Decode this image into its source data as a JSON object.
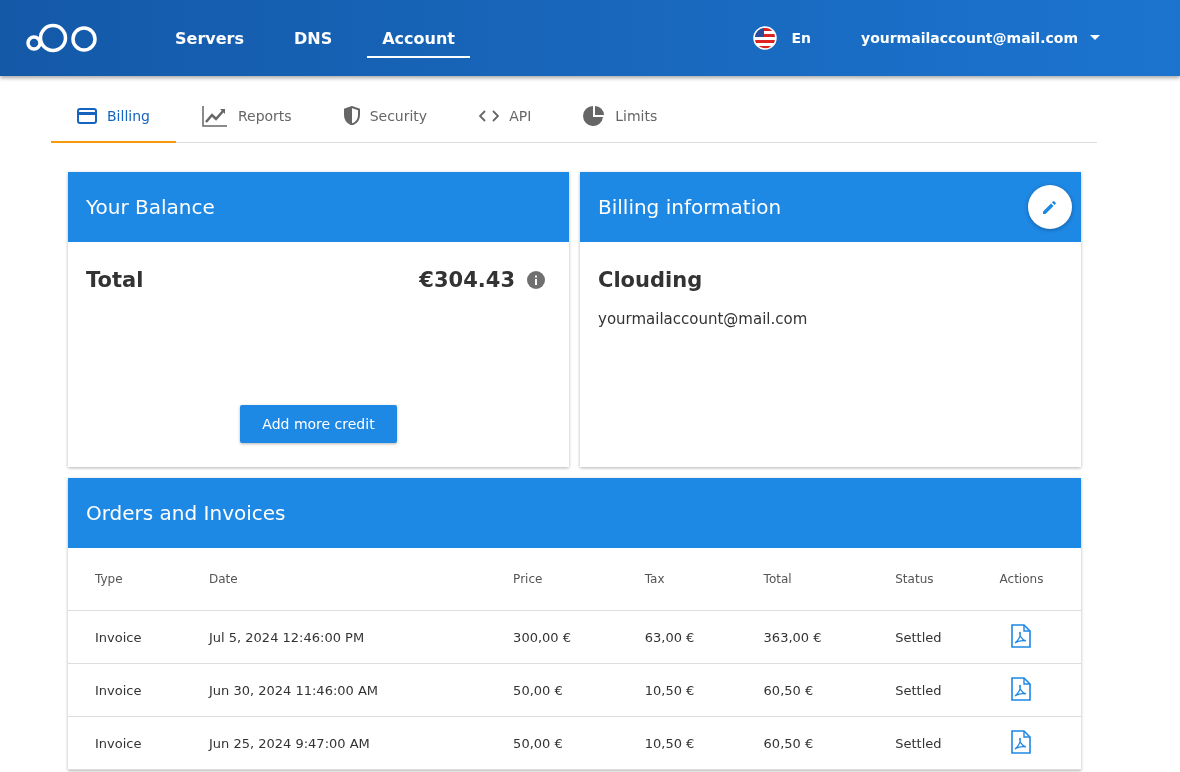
{
  "nav": {
    "items": [
      {
        "label": "Servers",
        "selected": false
      },
      {
        "label": "DNS",
        "selected": false
      },
      {
        "label": "Account",
        "selected": true
      }
    ],
    "language": "En",
    "account": "yourmailaccount@mail.com"
  },
  "tabs": [
    {
      "label": "Billing",
      "kind": "card",
      "selected": true
    },
    {
      "label": "Reports",
      "kind": "chart",
      "selected": false
    },
    {
      "label": "Security",
      "kind": "shield",
      "selected": false
    },
    {
      "label": "API",
      "kind": "code",
      "selected": false
    },
    {
      "label": "Limits",
      "kind": "pie",
      "selected": false
    }
  ],
  "balance": {
    "title": "Your Balance",
    "label": "Total",
    "amount": "€304.43",
    "button": "Add more credit"
  },
  "billing": {
    "title": "Billing information",
    "name": "Clouding",
    "email": "yourmailaccount@mail.com"
  },
  "orders": {
    "title": "Orders and Invoices",
    "columns": [
      "Type",
      "Date",
      "Price",
      "Tax",
      "Total",
      "Status",
      "Actions"
    ],
    "rows": [
      {
        "type": "Invoice",
        "date": "Jul 5, 2024 12:46:00 PM",
        "price": "300,00 €",
        "tax": "63,00 €",
        "total": "363,00 €",
        "status": "Settled"
      },
      {
        "type": "Invoice",
        "date": "Jun 30, 2024 11:46:00 AM",
        "price": "50,00 €",
        "tax": "10,50 €",
        "total": "60,50 €",
        "status": "Settled"
      },
      {
        "type": "Invoice",
        "date": "Jun 25, 2024 9:47:00 AM",
        "price": "50,00 €",
        "tax": "10,50 €",
        "total": "60,50 €",
        "status": "Settled"
      }
    ]
  }
}
